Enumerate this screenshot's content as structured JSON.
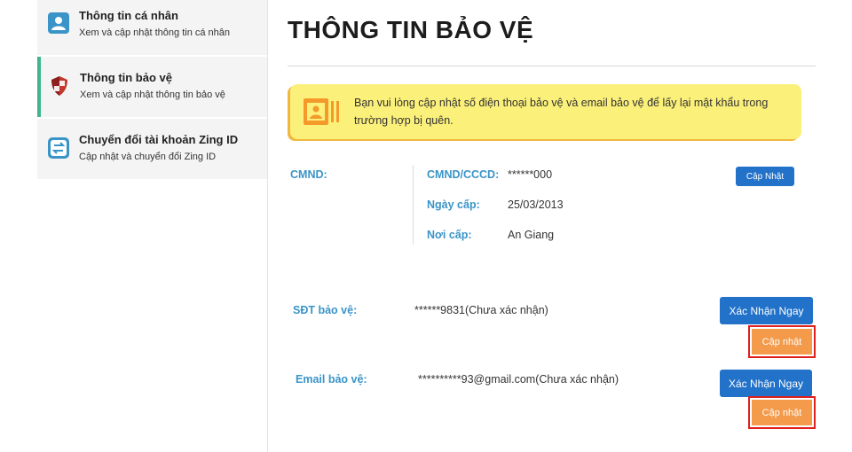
{
  "sidebar": {
    "items": [
      {
        "title": "Thông tin cá nhân",
        "subtitle": "Xem và cập nhật thông tin cá nhân",
        "icon": "user-card-icon"
      },
      {
        "title": "Thông tin bảo vệ",
        "subtitle": "Xem và cập nhật thông tin bảo vệ",
        "icon": "shield-icon",
        "active": true
      },
      {
        "title": "Chuyển đổi tài khoản Zing ID",
        "subtitle": "Cập nhật và chuyển đổi Zing ID",
        "icon": "swap-icon"
      }
    ]
  },
  "main": {
    "title": "THÔNG TIN BẢO VỆ",
    "notice": "Bạn vui lòng cập nhật số điện thoại bảo vệ và email bảo vệ để lấy lại mật khẩu trong trường hợp bị quên.",
    "cmnd": {
      "label": "CMND:",
      "id_label": "CMND/CCCD:",
      "id_value": "******000",
      "date_label": "Ngày cấp:",
      "date_value": "25/03/2013",
      "place_label": "Nơi cấp:",
      "place_value": "An Giang",
      "update_button": "Cập Nhật"
    },
    "phone": {
      "label": "SĐT bảo vệ:",
      "value": "******9831(Chưa xác nhận)",
      "verify_button": "Xác Nhận Ngay",
      "update_button": "Cập nhật"
    },
    "email": {
      "label": "Email bảo vệ:",
      "value": "**********93@gmail.com(Chưa xác nhận)",
      "verify_button": "Xác Nhận Ngay",
      "update_button": "Cập nhật"
    }
  },
  "colors": {
    "accent_blue": "#2272c9",
    "label_blue": "#3a94c8",
    "active_green": "#3fb68b",
    "notice_yellow": "#fbf07a",
    "orange": "#f39a4b",
    "highlight_red": "#e0201c"
  }
}
